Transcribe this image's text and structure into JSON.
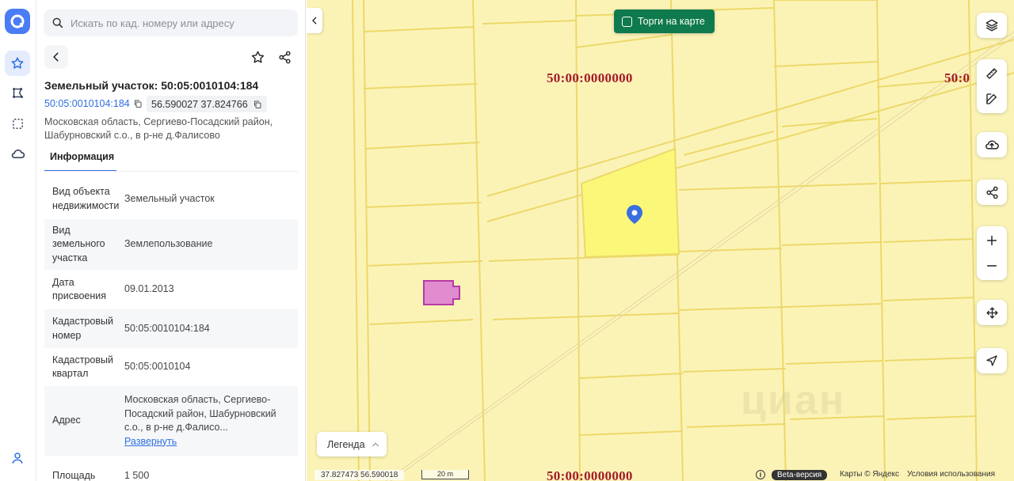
{
  "rail": {
    "logo": "logo-icon",
    "items": [
      {
        "name": "favorites",
        "icon": "star-icon",
        "active": true
      },
      {
        "name": "polygon",
        "icon": "polygon-icon",
        "active": false
      },
      {
        "name": "select-area",
        "icon": "dashed-square-icon",
        "active": false
      },
      {
        "name": "cloud",
        "icon": "cloud-icon",
        "active": false
      }
    ],
    "profile_icon": "user-icon"
  },
  "search": {
    "placeholder": "Искать по кад. номеру или адресу"
  },
  "object": {
    "title": "Земельный участок: 50:05:0010104:184",
    "cadastral_number": "50:05:0010104:184",
    "coordinates": "56.590027 37.824766",
    "address": "Московская область, Сергиево-Посадский район, Шабурновский с.о., в р-не д.Фалисово"
  },
  "tabs": [
    {
      "label": "Информация",
      "active": true
    }
  ],
  "info_rows": [
    {
      "key": "Вид объекта недвижимости",
      "value": "Земельный участок"
    },
    {
      "key": "Вид земельного участка",
      "value": "Землепользование"
    },
    {
      "key": "Дата присвоения",
      "value": "09.01.2013"
    },
    {
      "key": "Кадастровый номер",
      "value": "50:05:0010104:184"
    },
    {
      "key": "Кадастровый квартал",
      "value": "50:05:0010104"
    },
    {
      "key": "Адрес",
      "value": "Московская область, Сергиево-Посадский район, Шабурновский с.о., в р-не д.Фалисо...",
      "action": "Развернуть"
    },
    {
      "key": "Площадь",
      "value": "1 500"
    }
  ],
  "map": {
    "torgi_label": "Торги на карте",
    "zone_label": "50:00:0000000",
    "zone_label_partial": "50:0",
    "legend_label": "Легенда",
    "footer": {
      "coords": "37.827473   56.590018",
      "scale": "20 m",
      "info": "i",
      "beta": "Beta-версия",
      "copyright": "Карты © Яндекс",
      "terms": "Условия использования"
    },
    "watermark": "циан",
    "controls": [
      "layers-icon",
      "ruler-icon",
      "edit-icon",
      "upload-cloud-icon",
      "share-icon",
      "zoom-in-icon",
      "zoom-out-icon",
      "move-icon",
      "locate-icon"
    ],
    "colors": {
      "background": "#fbf3b6",
      "plot_line": "#ecd86a",
      "selected": "#fbf779",
      "marker": "#2f6fe0",
      "purple_object": "#e08ccf"
    }
  }
}
